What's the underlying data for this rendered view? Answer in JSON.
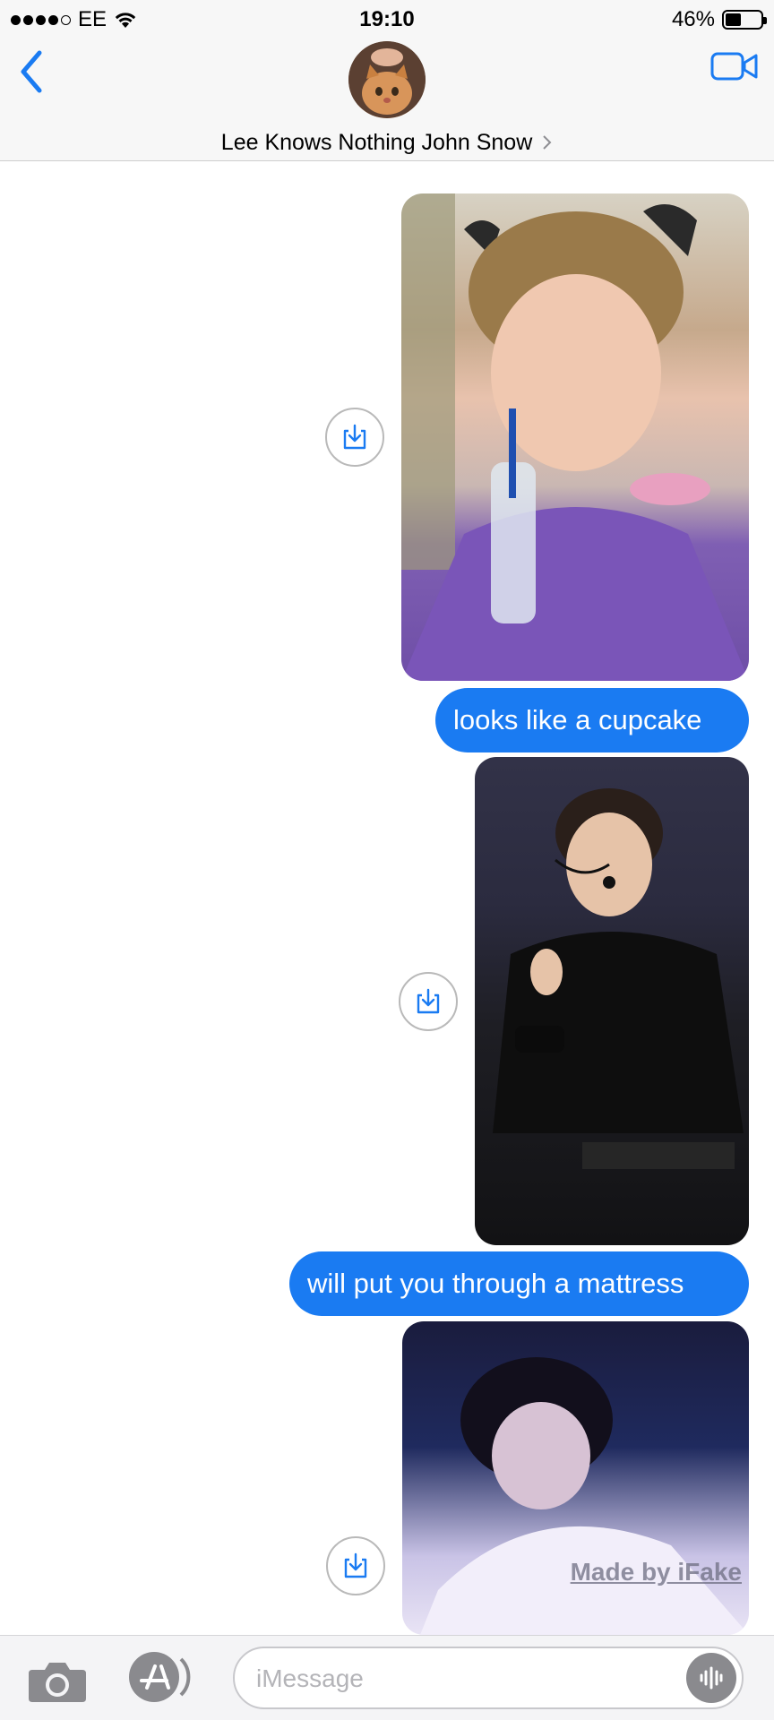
{
  "status_bar": {
    "carrier": "EE",
    "time": "19:10",
    "battery_percent_text": "46%",
    "battery_level": 0.46,
    "signal_bars_filled": 4,
    "signal_bars_total": 5
  },
  "header": {
    "contact_name": "Lee Knows Nothing John Snow",
    "back_icon": "chevron-left-icon",
    "video_icon": "video-camera-icon",
    "accent_color": "#1a7bf2"
  },
  "messages": [
    {
      "type": "image",
      "direction": "outgoing"
    },
    {
      "type": "text",
      "direction": "outgoing",
      "text": "looks like a cupcake"
    },
    {
      "type": "image",
      "direction": "outgoing"
    },
    {
      "type": "text",
      "direction": "outgoing",
      "text": "will put you through a mattress"
    },
    {
      "type": "image",
      "direction": "outgoing",
      "watermark": "Made by iFake"
    }
  ],
  "bubble_color": "#1a7bf2",
  "composer": {
    "placeholder": "iMessage",
    "camera_icon": "camera-icon",
    "appstore_icon": "app-store-icon",
    "audio_icon": "audio-waveform-icon"
  }
}
